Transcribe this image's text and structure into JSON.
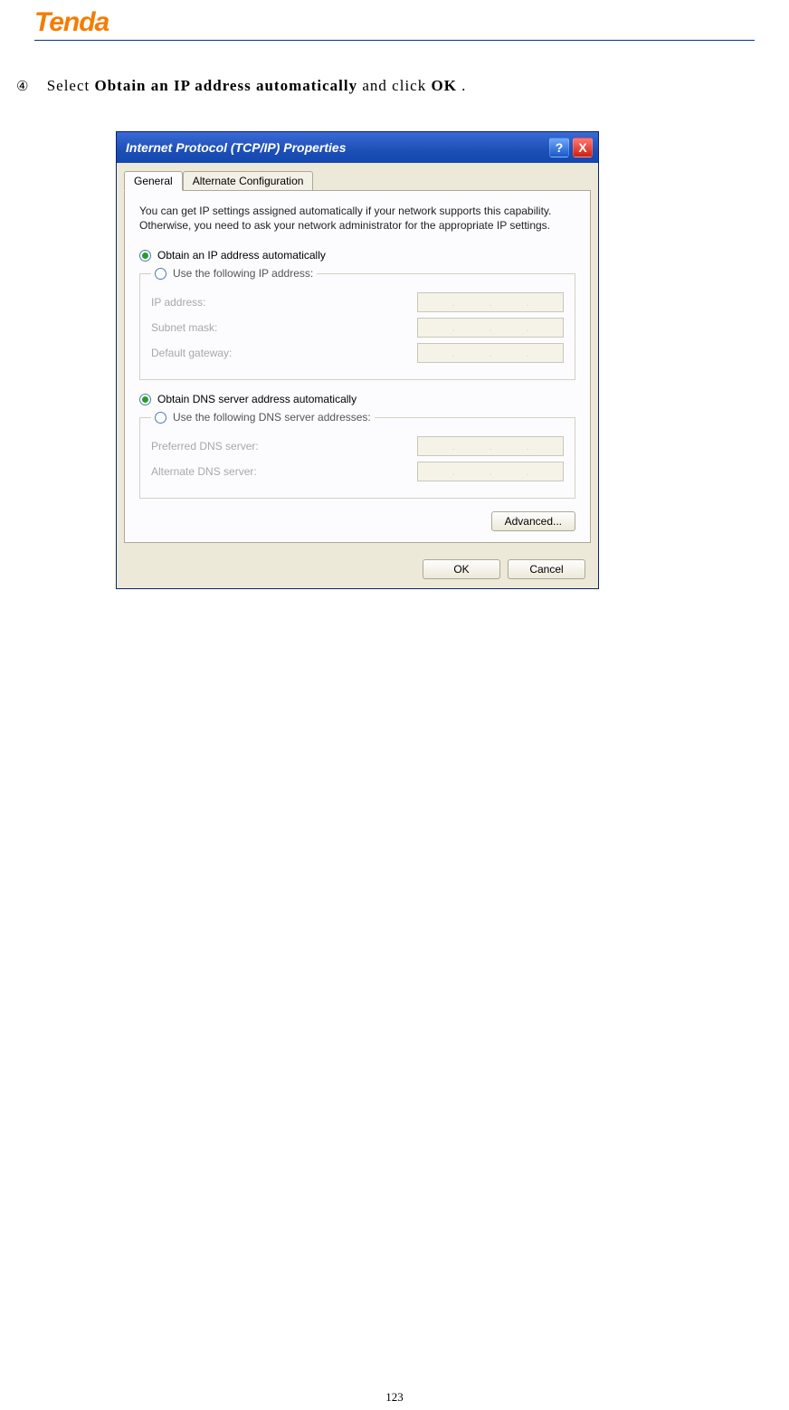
{
  "header": {
    "logo": "Tenda"
  },
  "instruction": {
    "step_marker": "④",
    "pre": "Select ",
    "bold1": "Obtain an IP address automatically",
    "mid": " and click ",
    "bold2": "OK",
    "end": "."
  },
  "dialog": {
    "title": "Internet Protocol (TCP/IP) Properties",
    "help_char": "?",
    "close_char": "X",
    "tabs": {
      "general": "General",
      "alternate": "Alternate Configuration"
    },
    "description": "You can get IP settings assigned automatically if your network supports this capability. Otherwise, you need to ask your network administrator for the appropriate IP settings.",
    "radios": {
      "obtain_ip": "Obtain an IP address automatically",
      "use_ip": "Use the following IP address:",
      "obtain_dns": "Obtain DNS server address automatically",
      "use_dns": "Use the following DNS server addresses:"
    },
    "fields": {
      "ip_address": "IP address:",
      "subnet": "Subnet mask:",
      "gateway": "Default gateway:",
      "preferred_dns": "Preferred DNS server:",
      "alternate_dns": "Alternate DNS server:"
    },
    "buttons": {
      "advanced": "Advanced...",
      "ok": "OK",
      "cancel": "Cancel"
    }
  },
  "page_number": "123"
}
